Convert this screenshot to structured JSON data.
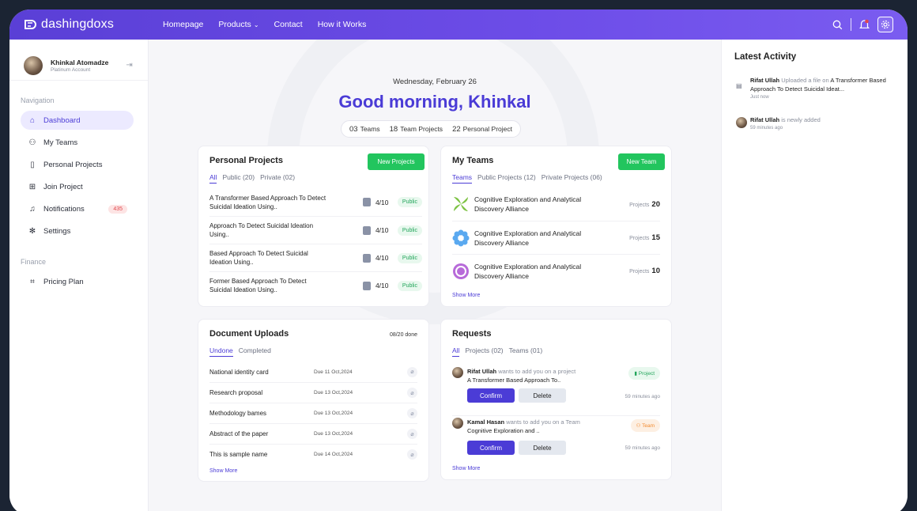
{
  "brand": {
    "name": "dashingdoxs"
  },
  "nav": {
    "items": [
      "Homepage",
      "Products",
      "Contact",
      "How it Works"
    ]
  },
  "user": {
    "name": "Khinkal Atomadze",
    "account": "Platinum Account"
  },
  "sidebar": {
    "nav_heading": "Navigation",
    "items": [
      {
        "label": "Dashboard",
        "icon": "home-icon"
      },
      {
        "label": "My Teams",
        "icon": "users-icon"
      },
      {
        "label": "Personal Projects",
        "icon": "file-user-icon"
      },
      {
        "label": "Join Project",
        "icon": "file-plus-icon"
      },
      {
        "label": "Notifications",
        "icon": "bell-icon",
        "badge": "435"
      },
      {
        "label": "Settings",
        "icon": "gear-icon"
      }
    ],
    "finance_heading": "Finance",
    "finance_items": [
      {
        "label": "Pricing Plan",
        "icon": "tag-icon"
      }
    ]
  },
  "header": {
    "date": "Wednesday, February 26",
    "greeting": "Good morning, Khinkal",
    "stats": [
      {
        "value": "03",
        "label": "Teams"
      },
      {
        "value": "18",
        "label": "Team Projects"
      },
      {
        "value": "22",
        "label": "Personal Project"
      }
    ]
  },
  "personal_projects": {
    "title": "Personal Projects",
    "button": "New Projects",
    "tabs": [
      "All",
      "Public (20)",
      "Private (02)"
    ],
    "rows": [
      {
        "title": "A Transformer Based Approach To Detect Suicidal Ideation Using..",
        "progress": "4/10",
        "status": "Public"
      },
      {
        "title": "Approach To Detect Suicidal Ideation Using..",
        "progress": "4/10",
        "status": "Public"
      },
      {
        "title": "Based Approach To Detect Suicidal Ideation Using..",
        "progress": "4/10",
        "status": "Public"
      },
      {
        "title": "Former Based Approach To Detect Suicidal Ideation Using..",
        "progress": "4/10",
        "status": "Public"
      }
    ]
  },
  "my_teams": {
    "title": "My Teams",
    "button": "New Team",
    "tabs": [
      "Teams",
      "Public Projects (12)",
      "Private Projects (06)"
    ],
    "rows": [
      {
        "name": "Cognitive Exploration and Analytical Discovery Alliance",
        "label": "Projects",
        "count": "20"
      },
      {
        "name": "Cognitive Exploration and Analytical Discovery Alliance",
        "label": "Projects",
        "count": "15"
      },
      {
        "name": "Cognitive Exploration and Analytical Discovery Alliance",
        "label": "Projects",
        "count": "10"
      }
    ],
    "show_more": "Show More"
  },
  "documents": {
    "title": "Document Uploads",
    "done": "08/20 done",
    "tabs": [
      "Undone",
      "Completed"
    ],
    "rows": [
      {
        "name": "National identity card",
        "due": "Due 11 Oct,2024"
      },
      {
        "name": "Research proposal",
        "due": "Due 13 Oct,2024"
      },
      {
        "name": "Methodology bames",
        "due": "Due 13 Oct,2024"
      },
      {
        "name": "Abstract of the paper",
        "due": "Due 13 Oct,2024"
      },
      {
        "name": "This is sample name",
        "due": "Due 14 Oct,2024"
      }
    ],
    "show_more": "Show More"
  },
  "requests": {
    "title": "Requests",
    "tabs": [
      "All",
      "Projects (02)",
      "Teams (01)"
    ],
    "items": [
      {
        "name": "Rifat Ullah",
        "text": "wants to add you on a project",
        "subject": "A Transformer Based Approach To..",
        "tag": "Project",
        "confirm": "Confirm",
        "delete": "Delete",
        "time": "59 minutes ago"
      },
      {
        "name": "Kamal Hasan",
        "text": "wants to add you on a Team",
        "subject": "Cognitive Exploration and ..",
        "tag": "Team",
        "confirm": "Confirm",
        "delete": "Delete",
        "time": "59 minutes ago"
      }
    ],
    "show_more": "Show More"
  },
  "activity": {
    "title": "Latest Activity",
    "items": [
      {
        "name": "Rifat Ullah",
        "text": "Uploaded a file on",
        "subject": "A Transformer Based Approach To Detect Suicidal Ideat...",
        "time": "Just now"
      },
      {
        "name": "Rifat Ullah",
        "text": "is newly added",
        "subject": "",
        "time": "59 minutes ago"
      }
    ]
  },
  "colors": {
    "primary": "#4b3cd6",
    "green": "#22c55e",
    "danger": "#e0474c",
    "orange": "#f28a2e"
  }
}
